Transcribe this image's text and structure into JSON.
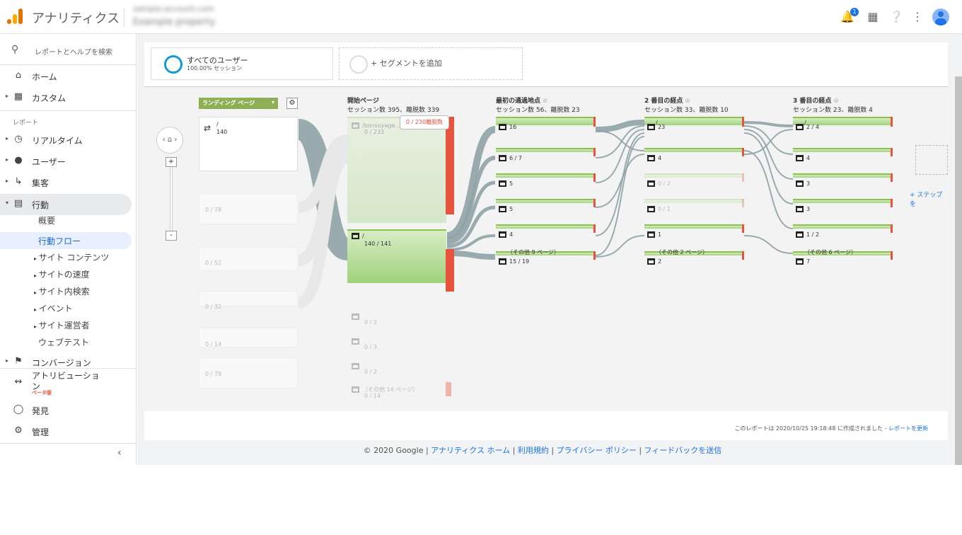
{
  "app": {
    "title": "アナリティクス",
    "account_line1": "sample-account.com",
    "account_line2": "Example property"
  },
  "topbar": {
    "notification_count": "1"
  },
  "search": {
    "placeholder": "レポートとヘルプを検索"
  },
  "sidebar": {
    "home": "ホーム",
    "custom": "カスタム",
    "reports_label": "レポート",
    "realtime": "リアルタイム",
    "audience": "ユーザー",
    "acquisition": "集客",
    "behavior": "行動",
    "behavior_sub": [
      "概要",
      "行動フロー",
      "サイト コンテンツ",
      "サイトの速度",
      "サイト内検索",
      "イベント",
      "サイト運営者",
      "ウェブテスト"
    ],
    "conversion": "コンバージョン",
    "attribution_line1": "アトリビューショ",
    "attribution_line2": "ン",
    "attribution_badge": "ベータ版",
    "discover": "発見",
    "admin": "管理"
  },
  "segments": {
    "all_users": "すべてのユーザー",
    "all_users_pct": "100.00% セッション",
    "add_segment": "+ セグメントを追加"
  },
  "flow": {
    "dimension_select": "ランディング ページ",
    "landing": [
      {
        "path": "/",
        "count": "140"
      },
      {
        "count": "0 / 78"
      },
      {
        "count": "0 / 52"
      },
      {
        "count": "0 / 32"
      },
      {
        "count": "0 / 14"
      },
      {
        "count": "0 / 79"
      }
    ],
    "start": {
      "title": "開始ページ",
      "stats": "セッション数 395、離脱数 339",
      "drop_label": "0 / 230離脱数",
      "nodes": [
        {
          "path": "/bonsoyage...",
          "count": "0 / 233"
        },
        {
          "path": "/",
          "count": "140 / 141"
        },
        {
          "count": "0 / 3"
        },
        {
          "count": "0 / 3"
        },
        {
          "count": "0 / 2"
        },
        {
          "path": "（その他 14 ページ）",
          "count": "0 / 14"
        }
      ]
    },
    "first": {
      "title": "最初の通過地点",
      "stats": "セッション数 56、離脱数 23",
      "nodes": [
        {
          "count": "16"
        },
        {
          "count": "6 / 7"
        },
        {
          "count": "5"
        },
        {
          "count": "5"
        },
        {
          "count": "4"
        },
        {
          "path": "（その他 9 ページ）",
          "count": "15 / 19"
        }
      ]
    },
    "second": {
      "title": "2 番目の経点",
      "stats": "セッション数 33、離脱数 10",
      "nodes": [
        {
          "path": "/",
          "count": "23"
        },
        {
          "count": "4"
        },
        {
          "count": "0 / 2"
        },
        {
          "count": "0 / 1"
        },
        {
          "count": "1"
        },
        {
          "path": "（その他 2 ページ）",
          "count": "2"
        }
      ]
    },
    "third": {
      "title": "3 番目の経点",
      "stats": "セッション数 23、離脱数 4",
      "nodes": [
        {
          "path": "/",
          "count": "2 / 4"
        },
        {
          "count": "4"
        },
        {
          "count": "3"
        },
        {
          "count": "3"
        },
        {
          "count": "1 / 2"
        },
        {
          "path": "（その他 6 ページ）",
          "count": "7"
        }
      ]
    },
    "add_step": "+ ステップを"
  },
  "report_note": {
    "text": "このレポートは 2020/10/25 19:18:48 に作成されました -",
    "link": "レポートを更新"
  },
  "footer": {
    "copyright": "© 2020 Google",
    "links": [
      "アナリティクス ホーム",
      "利用規約",
      "プライバシー ポリシー",
      "フィードバックを送信"
    ]
  },
  "colors": {
    "accent": "#1a73e8",
    "green": "#8bc34a",
    "exit_red": "#e8533e",
    "flow_link": "#8fa3a6"
  }
}
